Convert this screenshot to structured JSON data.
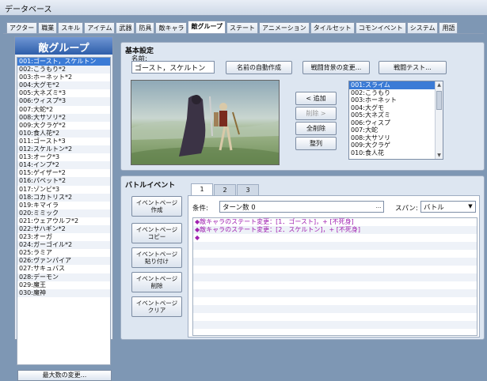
{
  "window": {
    "title": "データベース"
  },
  "tabs": [
    "アクター",
    "職業",
    "スキル",
    "アイテム",
    "武器",
    "防具",
    "敵キャラ",
    "敵グループ",
    "ステート",
    "アニメーション",
    "タイルセット",
    "コモンイベント",
    "システム",
    "用語"
  ],
  "active_tab": 7,
  "left": {
    "header": "敵グループ",
    "items": [
      "001:ゴースト，スケルトン",
      "002:こうもり*2",
      "003:ホーネット*2",
      "004:大グモ*2",
      "005:大ネズミ*3",
      "006:ウィスプ*3",
      "007:大蛇*2",
      "008:大サソリ*2",
      "009:大クラゲ*2",
      "010:食人花*2",
      "011:ゴースト*3",
      "012:スケルトン*2",
      "013:オーク*3",
      "014:インプ*2",
      "015:ゲイザー*2",
      "016:パペット*2",
      "017:ゾンビ*3",
      "018:コカトリス*2",
      "019:キマイラ",
      "020:ミミック",
      "021:ウェアウルフ*2",
      "022:サハギン*2",
      "023:オーガ",
      "024:ガーゴイル*2",
      "025:ラミア",
      "026:ヴァンパイア",
      "027:サキュバス",
      "028:デーモン",
      "029:魔王",
      "030:魔神"
    ],
    "selected": 0,
    "change_max_button": "最大数の変更..."
  },
  "basic": {
    "title": "基本設定",
    "name_label": "名前:",
    "name_value": "ゴースト，スケルトン",
    "auto_name_button": "名前の自動作成",
    "battleback_button": "戦闘背景の変更...",
    "battletest_button": "戦闘テスト...",
    "add_button": "< 追加",
    "remove_button": "削除 >",
    "clear_button": "全削除",
    "align_button": "整列",
    "troop_list": [
      "001:スライム",
      "002:こうもり",
      "003:ホーネット",
      "004:大グモ",
      "005:大ネズミ",
      "006:ウィスプ",
      "007:大蛇",
      "008:大サソリ",
      "009:大クラゲ",
      "010:食人花"
    ],
    "troop_selected": 0
  },
  "battle": {
    "title": "バトルイベント",
    "buttons": [
      "イベントページ\n作成",
      "イベントページ\nコピー",
      "イベントページ\n貼り付け",
      "イベントページ\n削除",
      "イベントページ\nクリア"
    ],
    "page_tabs": [
      "1",
      "2",
      "3"
    ],
    "condition_label": "条件:",
    "condition_value": "ターン数 0",
    "condition_dots": "...",
    "span_label": "スパン:",
    "span_value": "バトル",
    "commands": [
      "◆敵キャラのステート変更：[1．ゴースト]，+ [不死身]",
      "◆敵キャラのステート変更：[2．スケルトン]，+ [不死身]",
      "◆"
    ]
  },
  "colors": {
    "accent": "#3b7bd6",
    "command": "#a020b0"
  }
}
